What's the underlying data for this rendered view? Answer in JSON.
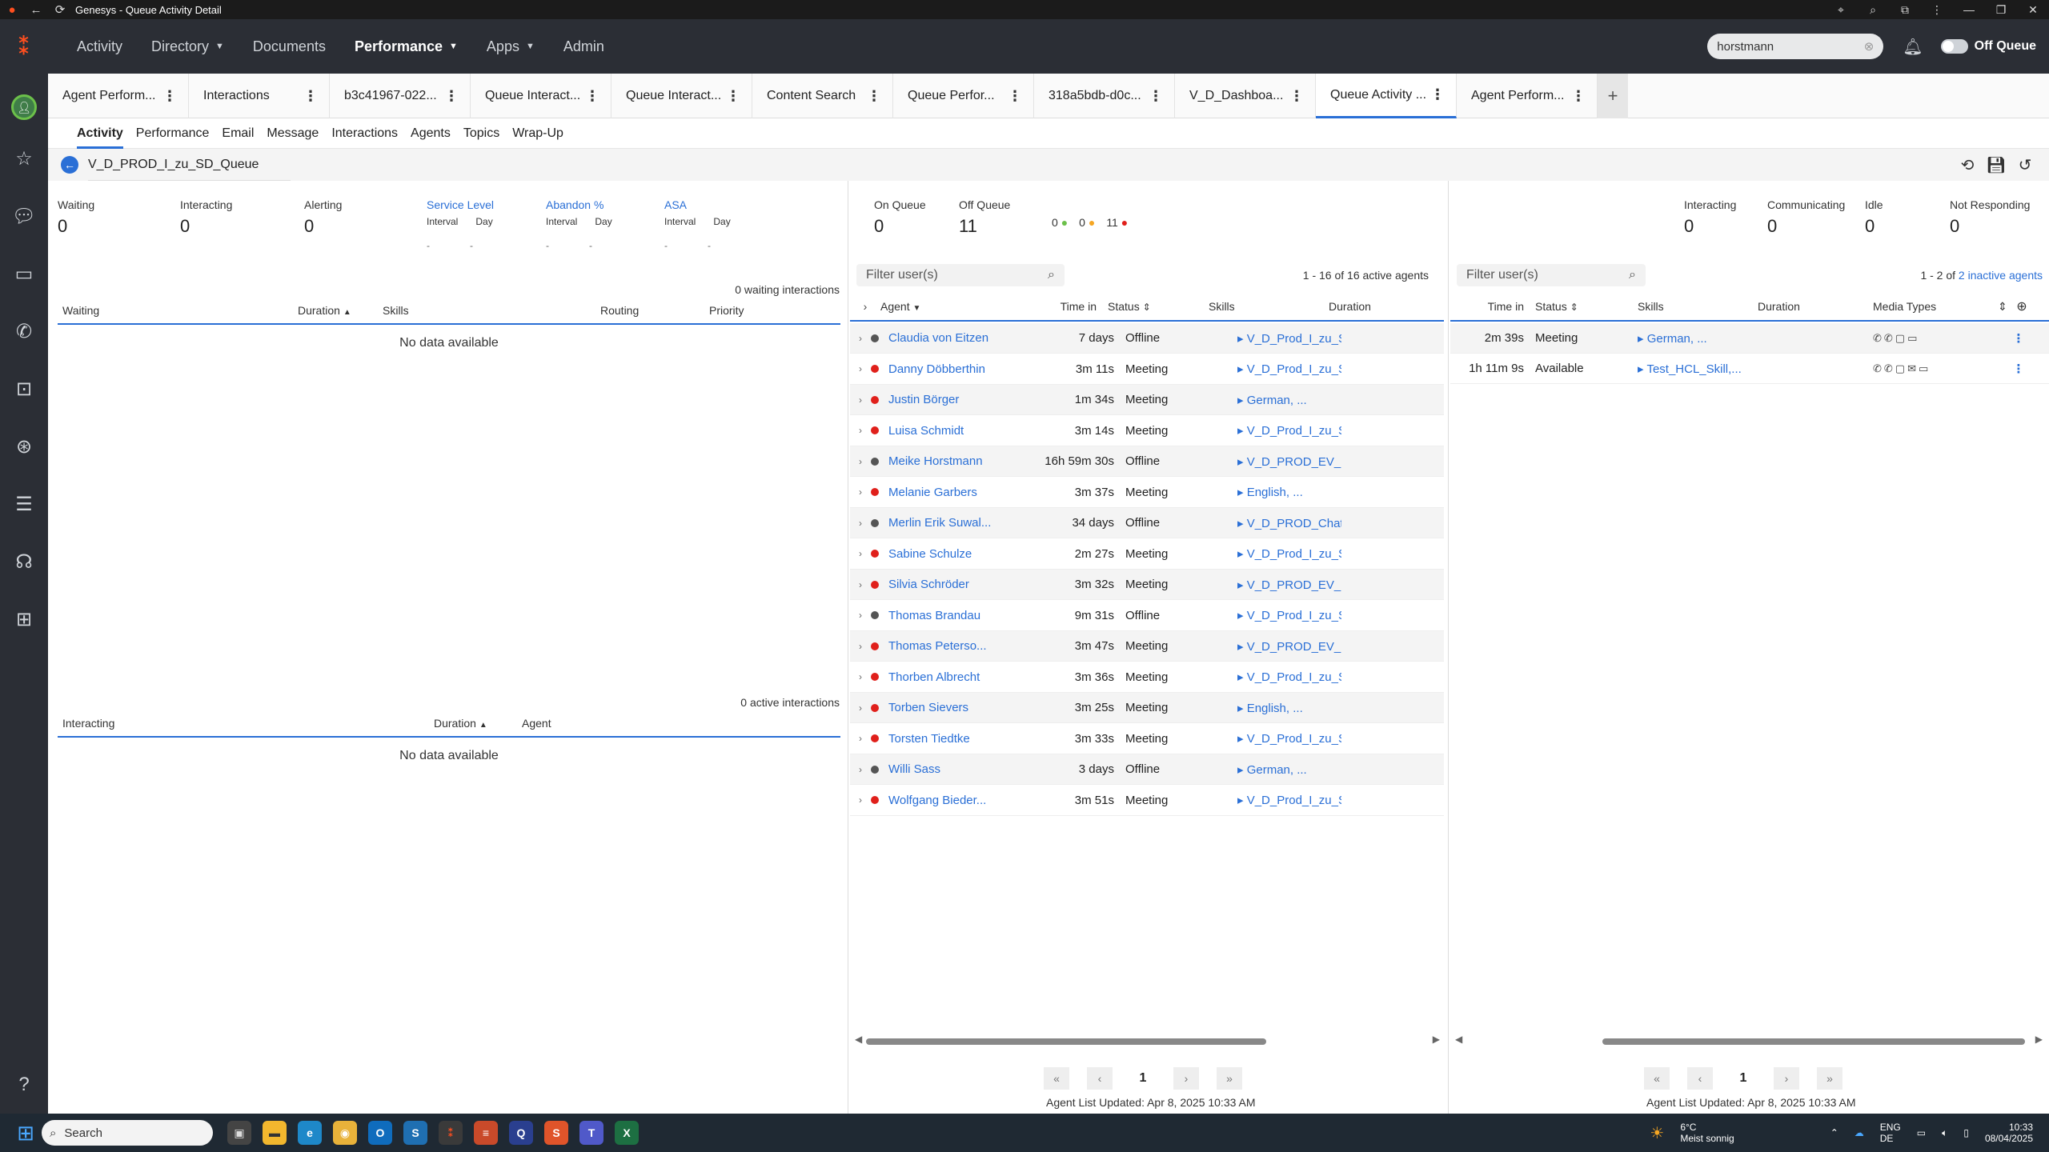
{
  "window": {
    "title": "Genesys - Queue Activity Detail"
  },
  "nav": {
    "items": [
      {
        "label": "Activity",
        "active": false,
        "caret": false
      },
      {
        "label": "Directory",
        "active": false,
        "caret": true
      },
      {
        "label": "Documents",
        "active": false,
        "caret": false
      },
      {
        "label": "Performance",
        "active": true,
        "caret": true
      },
      {
        "label": "Apps",
        "active": false,
        "caret": true
      },
      {
        "label": "Admin",
        "active": false,
        "caret": false
      }
    ],
    "search_value": "horstmann",
    "status_label": "Off Queue"
  },
  "tabs": [
    "Agent Perform...",
    "Interactions",
    "b3c41967-022...",
    "Queue Interact...",
    "Queue Interact...",
    "Content Search",
    "Queue Perfor...",
    "318a5bdb-d0c...",
    "V_D_Dashboa...",
    "Queue Activity ...",
    "Agent Perform..."
  ],
  "subtabs": [
    "Activity",
    "Performance",
    "Email",
    "Message",
    "Interactions",
    "Agents",
    "Topics",
    "Wrap-Up"
  ],
  "queue": {
    "name": "V_D_PROD_I_zu_SD_Queue"
  },
  "stats": {
    "waiting": {
      "label": "Waiting",
      "value": "0"
    },
    "interacting": {
      "label": "Interacting",
      "value": "0"
    },
    "alerting": {
      "label": "Alerting",
      "value": "0"
    },
    "service_level": {
      "label": "Service Level",
      "interval": "Interval",
      "day": "Day",
      "i_val": "-",
      "d_val": "-"
    },
    "abandon": {
      "label": "Abandon %",
      "interval": "Interval",
      "day": "Day",
      "i_val": "-",
      "d_val": "-"
    },
    "asa": {
      "label": "ASA",
      "interval": "Interval",
      "day": "Day",
      "i_val": "-",
      "d_val": "-"
    }
  },
  "waiting_table": {
    "count": "0 waiting interactions",
    "headers": [
      "Waiting",
      "Duration",
      "Skills",
      "Routing",
      "Priority"
    ],
    "empty": "No data available"
  },
  "interacting_table": {
    "count": "0 active interactions",
    "headers": [
      "Interacting",
      "Duration",
      "Agent"
    ],
    "empty": "No data available"
  },
  "agent_summary": {
    "on_queue_label": "On Queue",
    "on_queue": "0",
    "off_queue_label": "Off Queue",
    "off_queue": "11",
    "green": "0",
    "orange": "0",
    "red": "11",
    "interacting_label": "Interacting",
    "interacting": "0",
    "communicating_label": "Communicating",
    "communicating": "0",
    "idle_label": "Idle",
    "idle": "0",
    "not_responding_label": "Not Responding",
    "not_responding": "0"
  },
  "active_agents": {
    "filter_placeholder": "Filter user(s)",
    "count": "1 - 16 of 16 active agents",
    "headers": [
      "Agent",
      "Time in",
      "Status",
      "Skills",
      "Duration"
    ],
    "rows": [
      {
        "name": "Claudia von Eitzen",
        "time": "7 days",
        "status": "Offline",
        "skills": "V_D_Prod_I_zu_S",
        "dot": "#555555"
      },
      {
        "name": "Danny Döbberthin",
        "time": "3m 11s",
        "status": "Meeting",
        "skills": "V_D_Prod_I_zu_S",
        "dot": "#e0201b"
      },
      {
        "name": "Justin Börger",
        "time": "1m 34s",
        "status": "Meeting",
        "skills": "German, ...",
        "dot": "#e0201b"
      },
      {
        "name": "Luisa Schmidt",
        "time": "3m 14s",
        "status": "Meeting",
        "skills": "V_D_Prod_I_zu_S",
        "dot": "#e0201b"
      },
      {
        "name": "Meike Horstmann",
        "time": "16h 59m 30s",
        "status": "Offline",
        "skills": "V_D_PROD_EV_C",
        "dot": "#555555"
      },
      {
        "name": "Melanie Garbers",
        "time": "3m 37s",
        "status": "Meeting",
        "skills": "English, ...",
        "dot": "#e0201b"
      },
      {
        "name": "Merlin Erik Suwal...",
        "time": "34 days",
        "status": "Offline",
        "skills": "V_D_PROD_Chat",
        "dot": "#555555"
      },
      {
        "name": "Sabine Schulze",
        "time": "2m 27s",
        "status": "Meeting",
        "skills": "V_D_Prod_I_zu_S",
        "dot": "#e0201b"
      },
      {
        "name": "Silvia Schröder",
        "time": "3m 32s",
        "status": "Meeting",
        "skills": "V_D_PROD_EV_C",
        "dot": "#e0201b"
      },
      {
        "name": "Thomas Brandau",
        "time": "9m 31s",
        "status": "Offline",
        "skills": "V_D_Prod_I_zu_S",
        "dot": "#555555"
      },
      {
        "name": "Thomas Peterso...",
        "time": "3m 47s",
        "status": "Meeting",
        "skills": "V_D_PROD_EV_C",
        "dot": "#e0201b"
      },
      {
        "name": "Thorben Albrecht",
        "time": "3m 36s",
        "status": "Meeting",
        "skills": "V_D_Prod_I_zu_S",
        "dot": "#e0201b"
      },
      {
        "name": "Torben Sievers",
        "time": "3m 25s",
        "status": "Meeting",
        "skills": "English, ...",
        "dot": "#e0201b"
      },
      {
        "name": "Torsten Tiedtke",
        "time": "3m 33s",
        "status": "Meeting",
        "skills": "V_D_Prod_I_zu_S",
        "dot": "#e0201b"
      },
      {
        "name": "Willi Sass",
        "time": "3 days",
        "status": "Offline",
        "skills": "German, ...",
        "dot": "#555555"
      },
      {
        "name": "Wolfgang Bieder...",
        "time": "3m 51s",
        "status": "Meeting",
        "skills": "V_D_Prod_I_zu_S",
        "dot": "#e0201b"
      }
    ],
    "pager": {
      "first": "«",
      "prev": "‹",
      "page": "1",
      "next": "›",
      "last": "»"
    },
    "updated": "Agent List Updated: Apr 8, 2025 10:33 AM"
  },
  "inactive_agents": {
    "filter_placeholder": "Filter user(s)",
    "count_prefix": "1 - 2 of ",
    "count_link": "2 inactive agents",
    "headers": [
      "Time in",
      "Status",
      "Skills",
      "Duration",
      "Media Types"
    ],
    "rows": [
      {
        "time": "2m 39s",
        "status": "Meeting",
        "skills": "German, ..."
      },
      {
        "time": "1h 11m 9s",
        "status": "Available",
        "skills": "Test_HCL_Skill,..."
      }
    ],
    "pager": {
      "first": "«",
      "prev": "‹",
      "page": "1",
      "next": "›",
      "last": "»"
    },
    "updated": "Agent List Updated: Apr 8, 2025 10:33 AM"
  },
  "taskbar": {
    "search": "Search",
    "temp": "6°C",
    "weather": "Meist sonnig",
    "lang": "ENG",
    "region": "DE",
    "time": "10:33",
    "date": "08/04/2025"
  }
}
